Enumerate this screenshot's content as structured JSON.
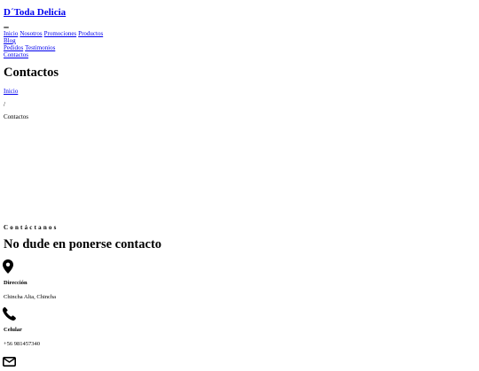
{
  "brand": "D´Toda Delicia",
  "nav": {
    "items": [
      "Inicio",
      "Nosotros",
      "Promociones",
      "Productos",
      "Blog",
      "Pedidos",
      "Testimonios",
      "Contactos"
    ]
  },
  "page_title": "Contactos",
  "breadcrumb": {
    "home": "Inicio",
    "separator": "/",
    "current": "Contactos"
  },
  "contact": {
    "eyebrow": "Contáctanos",
    "heading": "No dude en ponerse contacto",
    "address_label": "Dirección",
    "address_value": "Chincha Alta, Chincha",
    "phone_label": "Celular",
    "phone_value": "+56 981457340"
  },
  "icons": {
    "address": "map-marker-icon",
    "phone": "phone-icon",
    "email": "envelope-icon"
  }
}
